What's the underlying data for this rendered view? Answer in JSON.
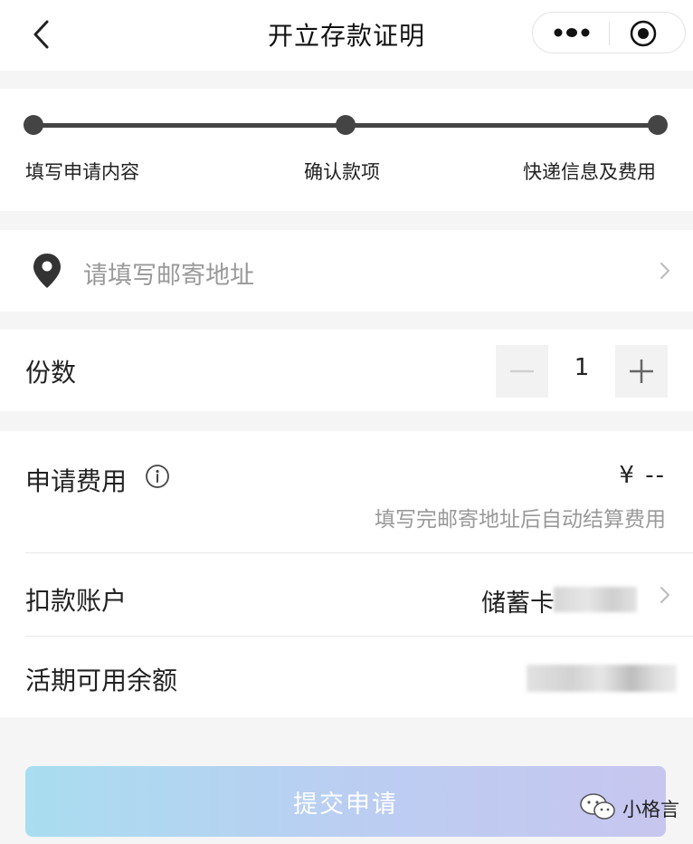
{
  "header": {
    "title": "开立存款证明"
  },
  "steps": [
    {
      "label": "填写申请内容"
    },
    {
      "label": "确认款项"
    },
    {
      "label": "快递信息及费用"
    }
  ],
  "address": {
    "placeholder": "请填写邮寄地址"
  },
  "quantity": {
    "label": "份数",
    "value": "1"
  },
  "fee": {
    "label": "申请费用",
    "amount": "¥ --",
    "hint": "填写完邮寄地址后自动结算费用"
  },
  "account": {
    "label": "扣款账户",
    "card_name": "储蓄卡"
  },
  "balance": {
    "label": "活期可用余额"
  },
  "submit_label": "提交申请",
  "watermark": {
    "text": "小格言"
  },
  "colors": {
    "step_line": "#444444",
    "button_gradient_start": "#a9ddf0",
    "button_gradient_end": "#c7c6ef",
    "placeholder": "#999999"
  },
  "icons": {
    "back": "chevron-left-icon",
    "more": "more-dots-icon",
    "close": "target-icon",
    "location": "location-pin-icon",
    "info": "info-icon",
    "arrow": "chevron-right-icon"
  }
}
